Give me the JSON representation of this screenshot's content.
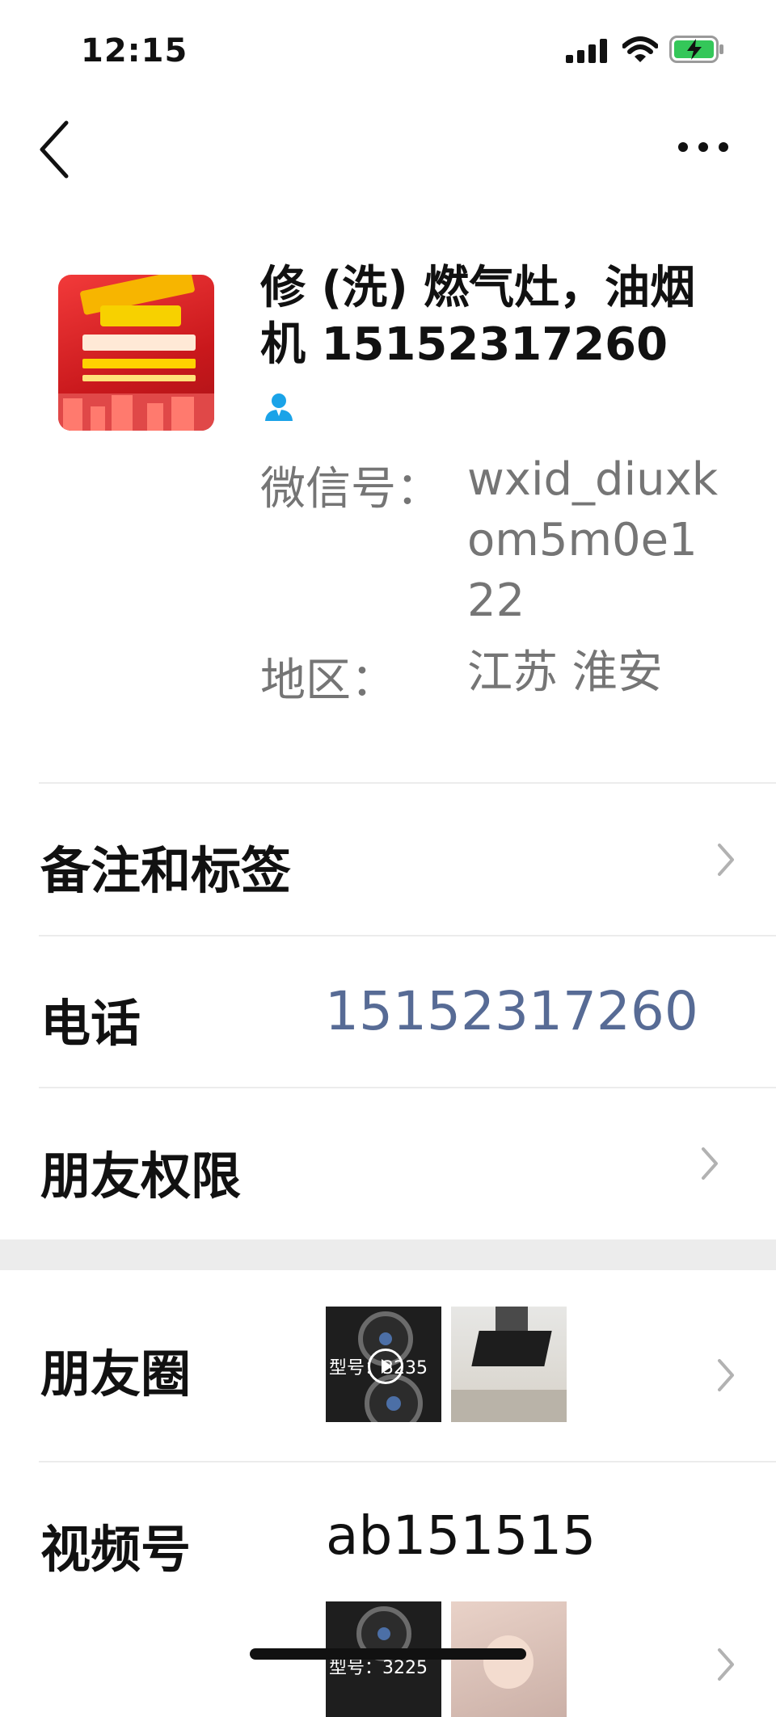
{
  "status_bar": {
    "time": "12:15",
    "battery_charging": true,
    "battery_color": "#34c759"
  },
  "nav": {
    "back_icon": "chevron-left-icon",
    "more_icon": "more-dots-icon"
  },
  "profile": {
    "name": "修 (洗) 燃气灶，油烟机 15152317260",
    "avatar_text": {
      "top_banner": "专业水电维修超划算",
      "lines": [
        "不出门 服务到家",
        "洪泽水电维修安装",
        "维修  清洗  安装",
        "油烟机  太阳能  热水器  燃气灶",
        "电话：15152317260"
      ]
    },
    "person_icon_color": "#1aa3e8",
    "wechat_id_label": "微信号：",
    "wechat_id": "wxid_diuxkom5m0e122",
    "region_label": "地区：",
    "region": "江苏 淮安"
  },
  "rows": {
    "notes_label": "备注和标签",
    "phone_label": "电话",
    "phone_value": "15152317260",
    "phone_color": "#576b95",
    "friend_perms_label": "朋友权限",
    "moments_label": "朋友圈",
    "moments_thumb_text": "型号：3235",
    "channels_label": "视频号",
    "channels_id": "ab151515",
    "channels_thumb_text": "型号：3225"
  }
}
